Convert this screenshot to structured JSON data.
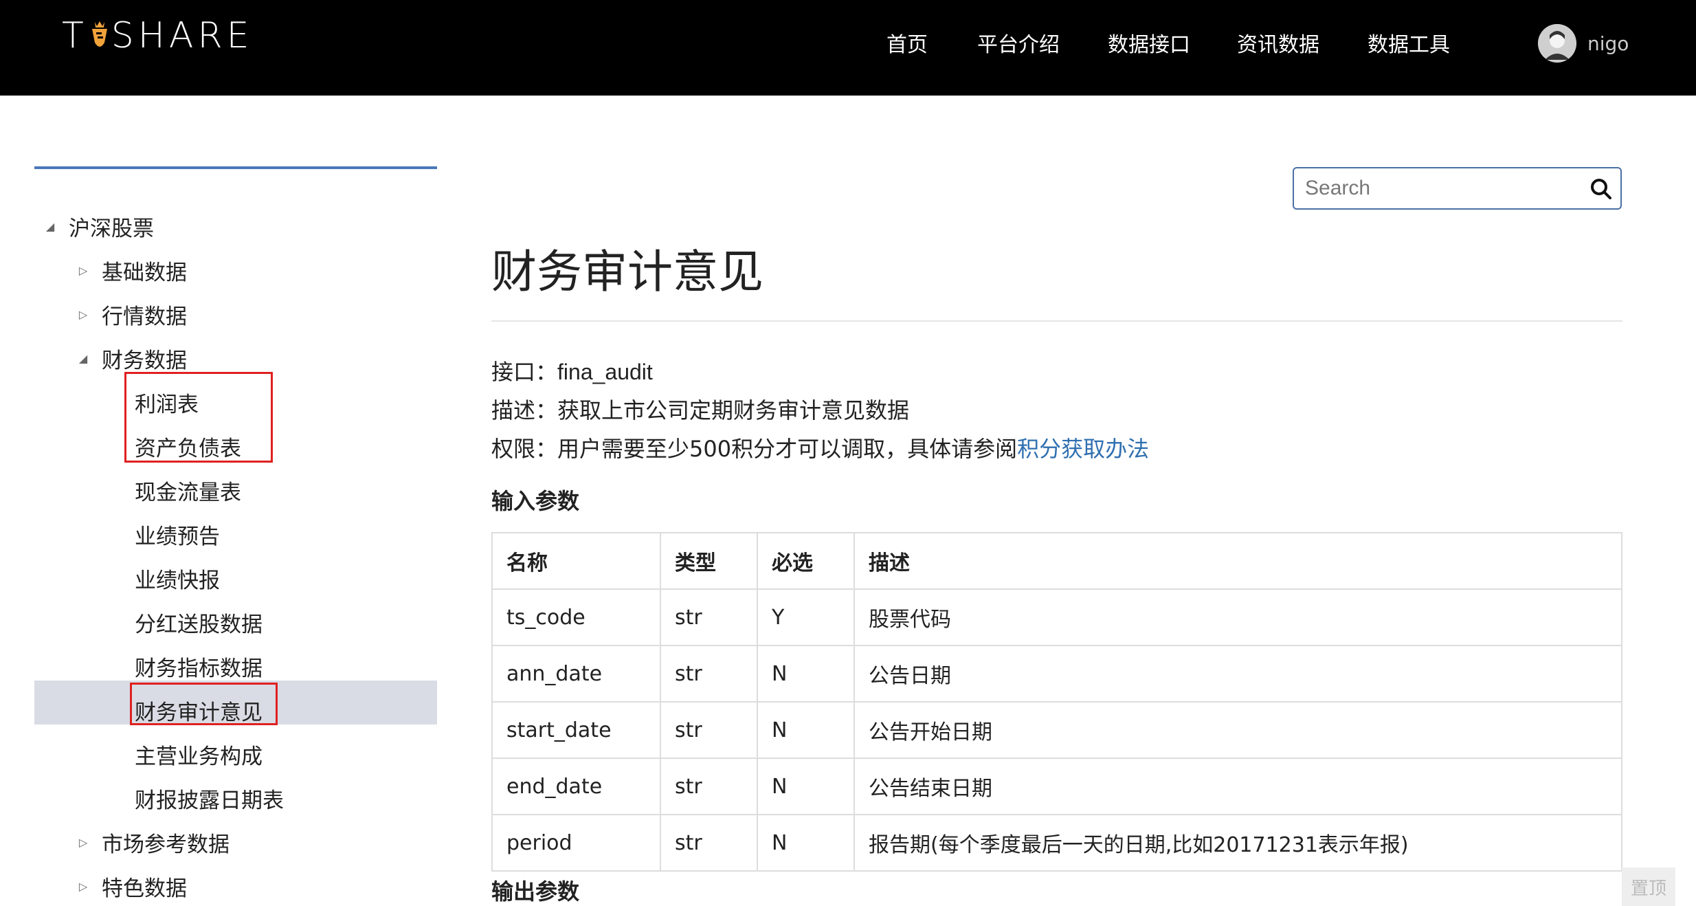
{
  "header": {
    "logo_text_left": "T",
    "logo_text_right": "SHARE",
    "nav": [
      "首页",
      "平台介绍",
      "数据接口",
      "资讯数据",
      "数据工具"
    ],
    "username": "nigo"
  },
  "search": {
    "placeholder": "Search"
  },
  "sidebar": {
    "items": [
      {
        "label": "沪深股票",
        "arrow": "◢",
        "level": 0
      },
      {
        "label": "基础数据",
        "arrow": "▷",
        "level": 1
      },
      {
        "label": "行情数据",
        "arrow": "▷",
        "level": 1
      },
      {
        "label": "财务数据",
        "arrow": "◢",
        "level": 1
      },
      {
        "label": "利润表",
        "level": 2
      },
      {
        "label": "资产负债表",
        "level": 2
      },
      {
        "label": "现金流量表",
        "level": 2
      },
      {
        "label": "业绩预告",
        "level": 2
      },
      {
        "label": "业绩快报",
        "level": 2
      },
      {
        "label": "分红送股数据",
        "level": 2
      },
      {
        "label": "财务指标数据",
        "level": 2
      },
      {
        "label": "财务审计意见",
        "level": 2,
        "selected": true
      },
      {
        "label": "主营业务构成",
        "level": 2
      },
      {
        "label": "财报披露日期表",
        "level": 2
      },
      {
        "label": "市场参考数据",
        "arrow": "▷",
        "level": 1
      },
      {
        "label": "特色数据",
        "arrow": "▷",
        "level": 1
      }
    ]
  },
  "main": {
    "title": "财务审计意见",
    "interface_label": "接口：",
    "interface_value": "fina_audit",
    "desc_label": "描述：",
    "desc_value": "获取上市公司定期财务审计意见数据",
    "perm_label": "权限：",
    "perm_value": "用户需要至少500积分才可以调取，具体请参阅",
    "perm_link": "积分获取办法",
    "input_params_title": "输入参数",
    "output_params_title": "输出参数",
    "table": {
      "headers": [
        "名称",
        "类型",
        "必选",
        "描述"
      ],
      "rows": [
        [
          "ts_code",
          "str",
          "Y",
          "股票代码"
        ],
        [
          "ann_date",
          "str",
          "N",
          "公告日期"
        ],
        [
          "start_date",
          "str",
          "N",
          "公告开始日期"
        ],
        [
          "end_date",
          "str",
          "N",
          "公告结束日期"
        ],
        [
          "period",
          "str",
          "N",
          "报告期(每个季度最后一天的日期,比如20171231表示年报)"
        ]
      ]
    }
  },
  "to_top": "置顶",
  "colors": {
    "accent": "#4a78b8",
    "link": "#2f6fb0",
    "highlight_box": "#e02020",
    "selected_bg": "#d9dce4"
  }
}
